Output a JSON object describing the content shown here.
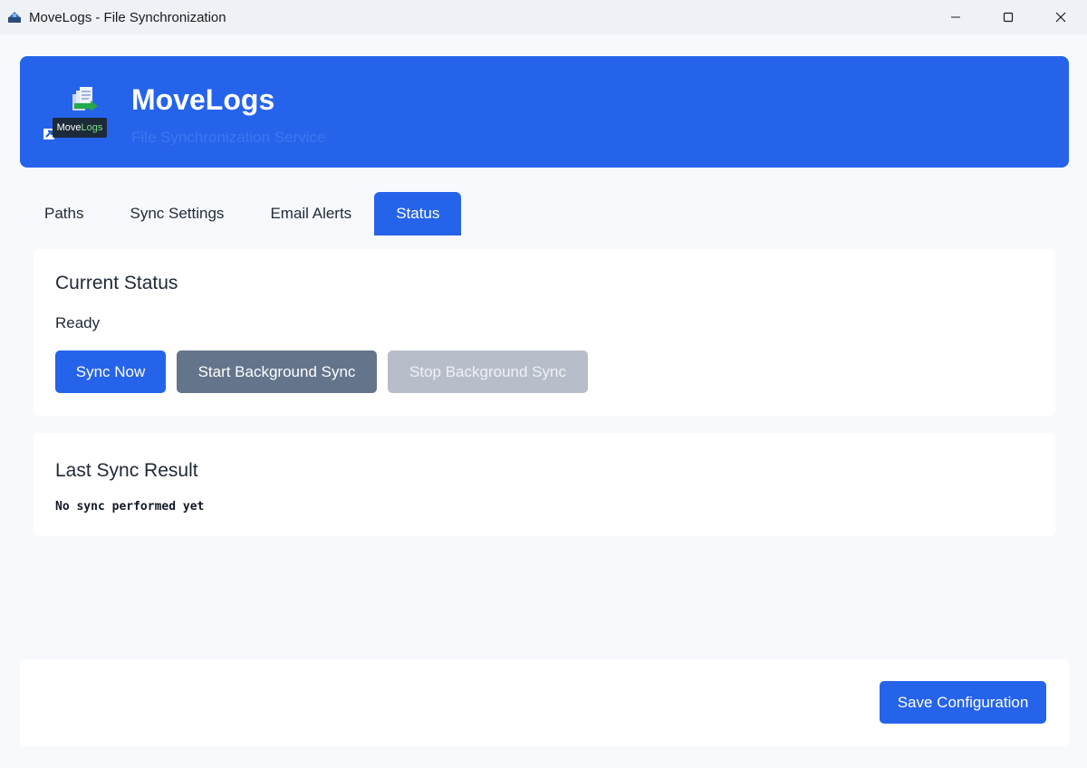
{
  "window": {
    "title": "MoveLogs - File Synchronization",
    "app_icon": "movelogs-app-icon",
    "controls": [
      "minimize-icon",
      "maximize-icon",
      "close-icon"
    ]
  },
  "header": {
    "logo_text_main": "Move",
    "logo_text_accent": "Logs",
    "title": "MoveLogs",
    "subtitle": "File Synchronization Service"
  },
  "tabs": [
    {
      "label": "Paths",
      "active": false
    },
    {
      "label": "Sync Settings",
      "active": false
    },
    {
      "label": "Email Alerts",
      "active": false
    },
    {
      "label": "Status",
      "active": true
    }
  ],
  "status_card": {
    "title": "Current Status",
    "status": "Ready",
    "buttons": {
      "sync_now": "Sync Now",
      "start_background": "Start Background Sync",
      "stop_background": "Stop Background Sync"
    }
  },
  "result_card": {
    "title": "Last Sync Result",
    "text": "No sync performed yet"
  },
  "footer": {
    "save_label": "Save Configuration"
  },
  "colors": {
    "primary": "#2563eb",
    "secondary": "#64748b",
    "disabled": "#b8bec9"
  }
}
